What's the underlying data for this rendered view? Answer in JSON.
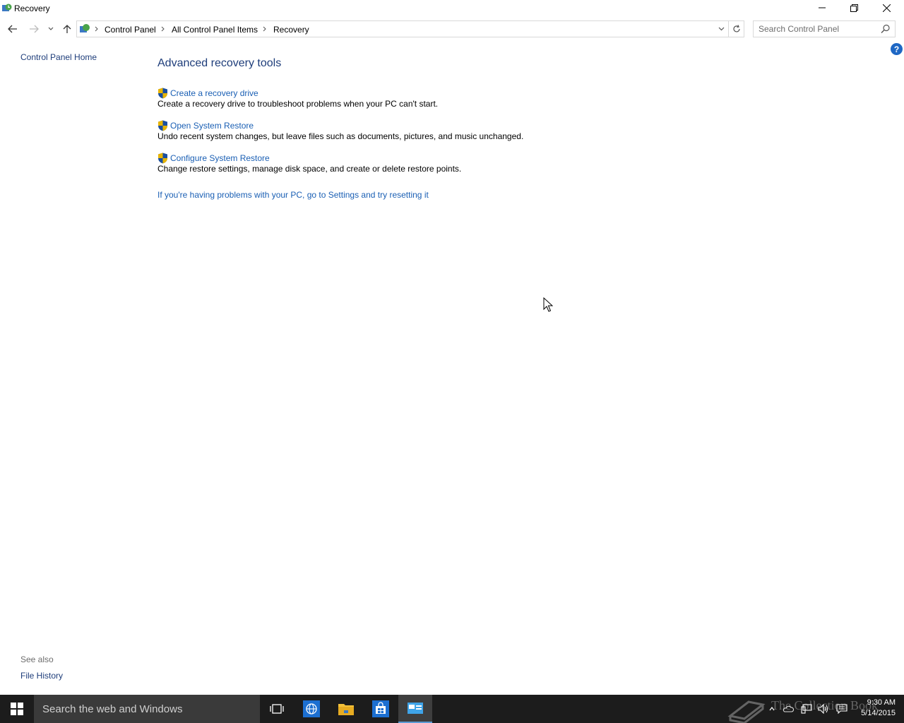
{
  "window": {
    "title": "Recovery",
    "controls": {
      "minimize": "minimize",
      "restore": "restore",
      "close": "close"
    }
  },
  "navigation": {
    "breadcrumbs": [
      "Control Panel",
      "All Control Panel Items",
      "Recovery"
    ],
    "search_placeholder": "Search Control Panel"
  },
  "sidebar": {
    "home_link": "Control Panel Home",
    "see_also_label": "See also",
    "see_also_items": [
      "File History"
    ]
  },
  "main": {
    "heading": "Advanced recovery tools",
    "tasks": [
      {
        "link": "Create a recovery drive",
        "description": "Create a recovery drive to troubleshoot problems when your PC can't start."
      },
      {
        "link": "Open System Restore",
        "description": "Undo recent system changes, but leave files such as documents, pictures, and music unchanged."
      },
      {
        "link": "Configure System Restore",
        "description": "Change restore settings, manage disk space, and create or delete restore points."
      }
    ],
    "reset_link": "If you're having problems with your PC, go to Settings and try resetting it"
  },
  "taskbar": {
    "search_placeholder": "Search the web and Windows",
    "pinned": [
      "task-view-icon",
      "internet-explorer-icon",
      "file-explorer-icon",
      "store-icon",
      "control-panel-icon"
    ],
    "clock_time": "9:30 AM",
    "clock_date": "5/14/2015",
    "watermark": "The Collection Book"
  },
  "colors": {
    "link": "#1a5fb4",
    "heading": "#1e3d7a",
    "taskbar": "#1c1c1c",
    "help": "#1e67c4"
  }
}
